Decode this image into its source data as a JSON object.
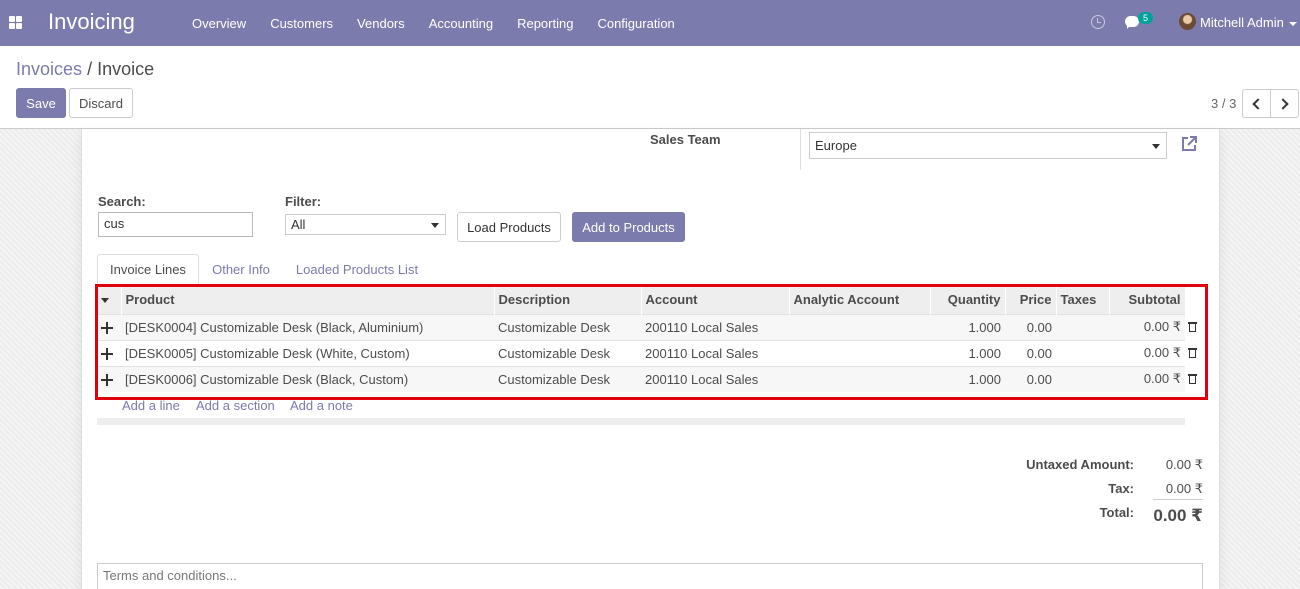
{
  "app": {
    "title": "Invoicing",
    "menu": [
      "Overview",
      "Customers",
      "Vendors",
      "Accounting",
      "Reporting",
      "Configuration"
    ],
    "chat_count": "5",
    "user": "Mitchell Admin",
    "accent_color": "#7c7bad"
  },
  "control": {
    "breadcrumb_parent": "Invoices",
    "breadcrumb_sep": "/",
    "breadcrumb_current": "Invoice",
    "save_label": "Save",
    "discard_label": "Discard",
    "pager": "3 / 3"
  },
  "form": {
    "sales_team_label": "Sales Team",
    "sales_team_value": "Europe",
    "search_label": "Search:",
    "search_value": "cus",
    "filter_label": "Filter:",
    "filter_value": "All",
    "load_products": "Load Products",
    "add_to_products": "Add to Products"
  },
  "tabs": [
    "Invoice Lines",
    "Other Info",
    "Loaded Products List"
  ],
  "lines": {
    "headers": {
      "product": "Product",
      "description": "Description",
      "account": "Account",
      "analytic": "Analytic Account",
      "quantity": "Quantity",
      "price": "Price",
      "taxes": "Taxes",
      "subtotal": "Subtotal"
    },
    "rows": [
      {
        "product": "[DESK0004] Customizable Desk (Black, Aluminium)",
        "description": "Customizable Desk",
        "account": "200110 Local Sales",
        "analytic": "",
        "quantity": "1.000",
        "price": "0.00",
        "taxes": "",
        "subtotal": "0.00 ₹"
      },
      {
        "product": "[DESK0005] Customizable Desk (White, Custom)",
        "description": "Customizable Desk",
        "account": "200110 Local Sales",
        "analytic": "",
        "quantity": "1.000",
        "price": "0.00",
        "taxes": "",
        "subtotal": "0.00 ₹"
      },
      {
        "product": "[DESK0006] Customizable Desk (Black, Custom)",
        "description": "Customizable Desk",
        "account": "200110 Local Sales",
        "analytic": "",
        "quantity": "1.000",
        "price": "0.00",
        "taxes": "",
        "subtotal": "0.00 ₹"
      }
    ],
    "add_line": "Add a line",
    "add_section": "Add a section",
    "add_note": "Add a note"
  },
  "totals": {
    "untaxed_label": "Untaxed Amount:",
    "untaxed_value": "0.00 ₹",
    "tax_label": "Tax:",
    "tax_value": "0.00 ₹",
    "total_label": "Total:",
    "total_value": "0.00 ₹"
  },
  "terms_placeholder": "Terms and conditions..."
}
